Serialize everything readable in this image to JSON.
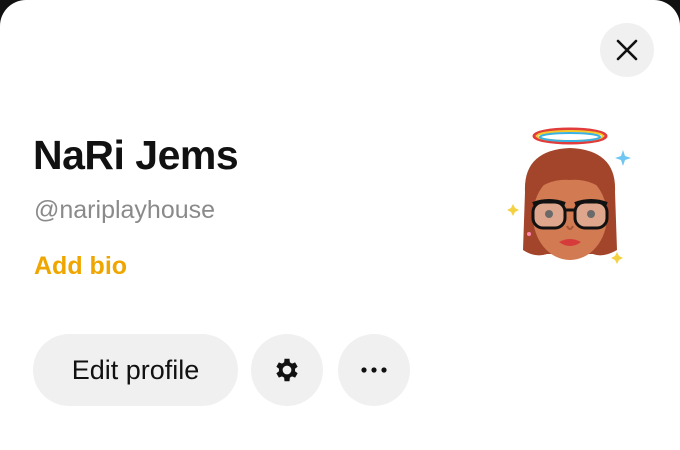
{
  "profile": {
    "display_name": "NaRi Jems",
    "username": "@nariplayhouse",
    "add_bio_label": "Add bio"
  },
  "actions": {
    "edit_profile_label": "Edit profile",
    "settings_icon": "gear-icon",
    "more_icon": "more-horizontal-icon",
    "close_icon": "close-icon"
  },
  "colors": {
    "accent": "#f0a600",
    "button_bg": "#f0f0f0",
    "text_primary": "#111111",
    "text_secondary": "#8a8a8a"
  }
}
